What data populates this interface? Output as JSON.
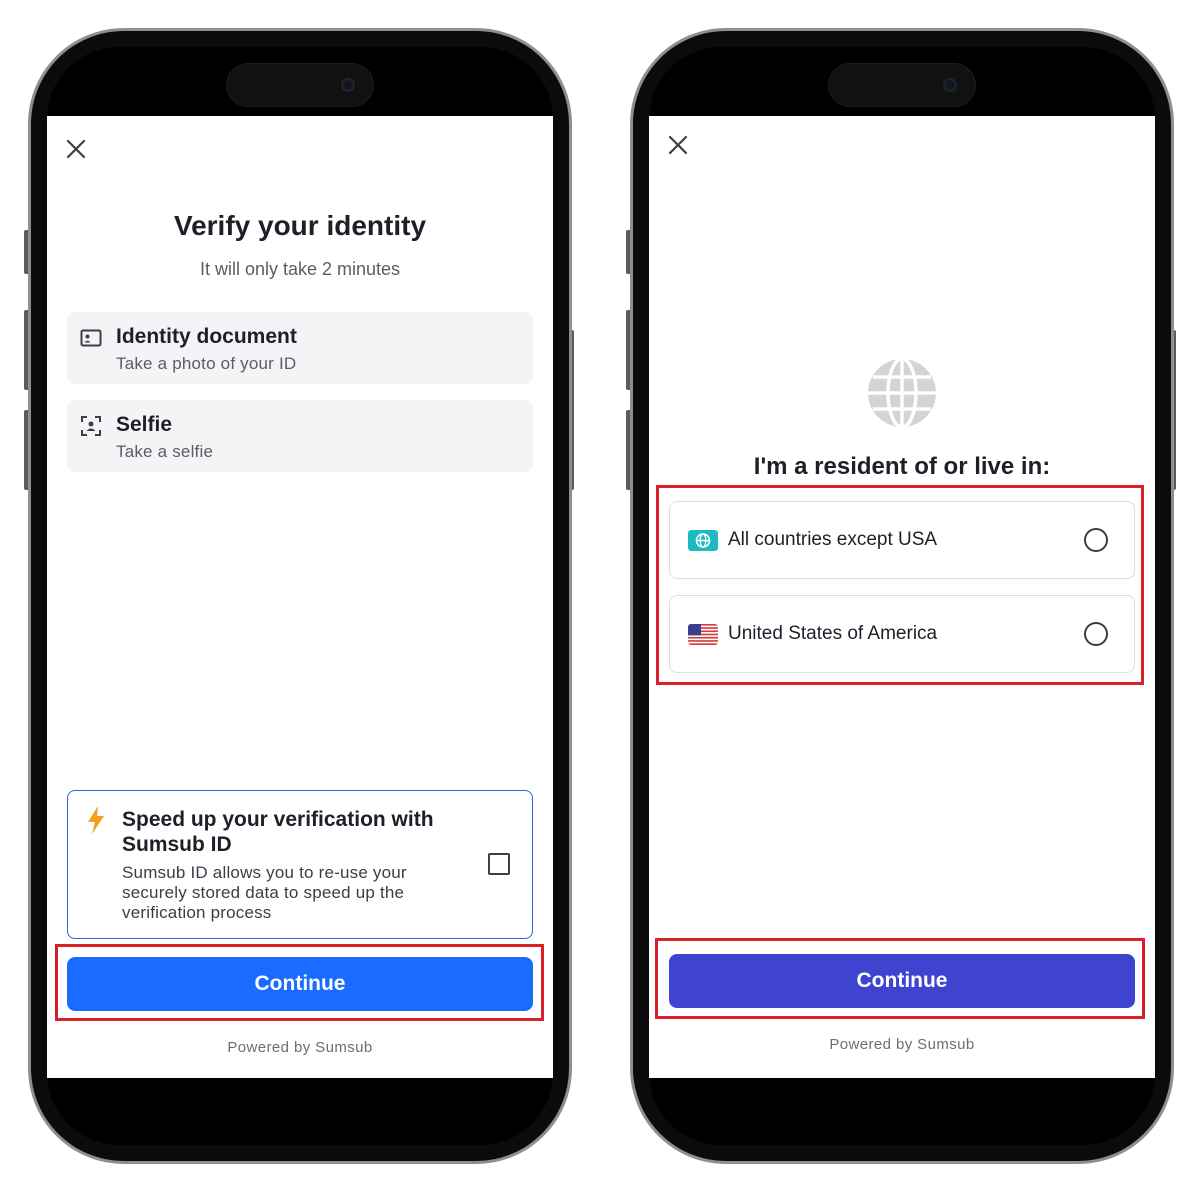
{
  "accent_colors": {
    "continue_blue": "#1a6bff",
    "continue_indigo": "#3e44d0",
    "highlight_red": "#d9202a",
    "bolt_orange": "#f0a020"
  },
  "screen1": {
    "close_icon": "close-icon",
    "title": "Verify your identity",
    "subtitle": "It will only take 2 minutes",
    "steps": [
      {
        "icon": "id-card-icon",
        "title": "Identity document",
        "subtitle": "Take a photo of your ID"
      },
      {
        "icon": "face-scan-icon",
        "title": "Selfie",
        "subtitle": "Take a selfie"
      }
    ],
    "sumsub_card": {
      "icon": "lightning-bolt-icon",
      "title": "Speed up your verification with Sumsub ID",
      "description": "Sumsub ID allows you to re-use your securely stored data to speed up the verification process",
      "checked": false
    },
    "continue_label": "Continue",
    "powered_by": "Powered by Sumsub"
  },
  "screen2": {
    "close_icon": "close-icon",
    "globe_icon": "globe-icon",
    "title": "I'm a resident of or live in:",
    "options": [
      {
        "icon": "globe-flag-icon",
        "label": "All countries except USA",
        "selected": false
      },
      {
        "icon": "us-flag-icon",
        "label": "United States of America",
        "selected": false
      }
    ],
    "continue_label": "Continue",
    "powered_by": "Powered by Sumsub"
  }
}
